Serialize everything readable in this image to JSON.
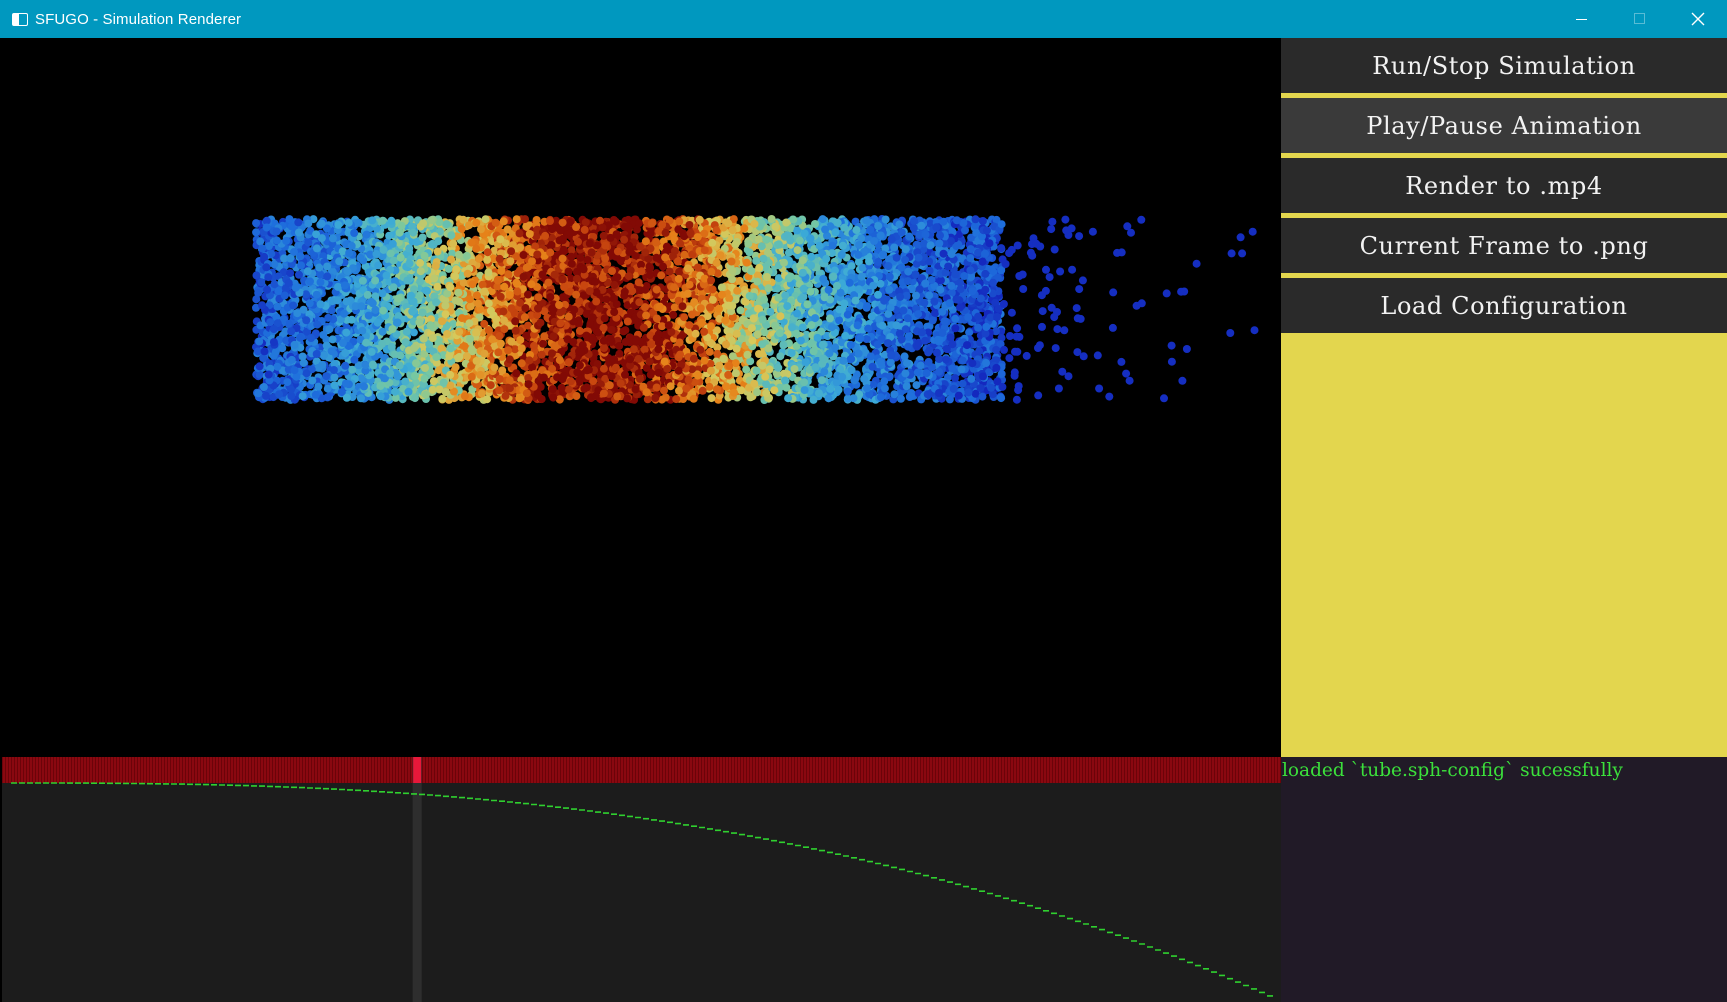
{
  "window": {
    "title": "SFUGO - Simulation Renderer"
  },
  "sidebar": {
    "buttons": [
      {
        "label": "Run/Stop Simulation"
      },
      {
        "label": "Play/Pause Animation"
      },
      {
        "label": "Render to .mp4"
      },
      {
        "label": "Current Frame to .png"
      },
      {
        "label": "Load Configuration"
      }
    ]
  },
  "console": {
    "lines": [
      "loaded `tube.sph-config` sucessfully"
    ]
  },
  "timeline": {
    "playhead_fraction": 0.325
  },
  "colors": {
    "titlebar": "#0098bf",
    "panel_background": "#e3d64e",
    "button_background": "#2a2a2a",
    "button_separator": "#e3d64e",
    "frame_strip": "#8a0810",
    "playhead": "#e8183a",
    "curve": "#2fd02f",
    "console_background": "#211a27",
    "console_text": "#3be03b"
  },
  "icons": [
    "app-window-icon",
    "minimize-icon",
    "maximize-icon",
    "close-icon"
  ]
}
